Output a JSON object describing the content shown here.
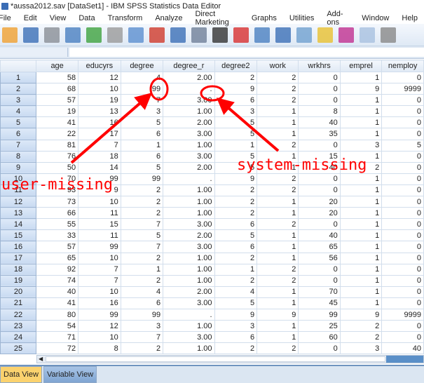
{
  "window": {
    "title": "*aussa2012.sav [DataSet1] - IBM SPSS Statistics Data Editor"
  },
  "menu": [
    "File",
    "Edit",
    "View",
    "Data",
    "Transform",
    "Analyze",
    "Direct Marketing",
    "Graphs",
    "Utilities",
    "Add-ons",
    "Window",
    "Help"
  ],
  "toolbar": [
    {
      "icon": "open-folder-icon",
      "color": "#f0a030"
    },
    {
      "icon": "save-icon",
      "color": "#3b6fb6"
    },
    {
      "icon": "print-icon",
      "color": "#8a8f96"
    },
    {
      "icon": "recall-dialog-icon",
      "color": "#4a7fc0"
    },
    {
      "icon": "undo-icon",
      "color": "#3fa33f"
    },
    {
      "icon": "redo-icon",
      "color": "#9a9a9a"
    },
    {
      "icon": "goto-case-icon",
      "color": "#5b8fd0"
    },
    {
      "icon": "goto-variable-icon",
      "color": "#d03a2a"
    },
    {
      "icon": "variables-icon",
      "color": "#3b6fb6"
    },
    {
      "icon": "run-descriptives-icon",
      "color": "#6f7f99"
    },
    {
      "icon": "find-icon",
      "color": "#333333"
    },
    {
      "icon": "insert-cases-icon",
      "color": "#d83030"
    },
    {
      "icon": "insert-variable-icon",
      "color": "#4a7fc0"
    },
    {
      "icon": "split-file-icon",
      "color": "#3b6fb6"
    },
    {
      "icon": "weight-cases-icon",
      "color": "#6fa0d0"
    },
    {
      "icon": "select-cases-icon",
      "color": "#e8c030"
    },
    {
      "icon": "value-labels-icon",
      "color": "#c03090"
    },
    {
      "icon": "use-sets-icon",
      "color": "#a8c0e0"
    },
    {
      "icon": "show-all-icon",
      "color": "#888888"
    }
  ],
  "grid": {
    "columns": [
      "age",
      "educyrs",
      "degree",
      "degree_r",
      "degree2",
      "work",
      "wrkhrs",
      "emprel",
      "nemploy"
    ],
    "rows": [
      [
        "1",
        "58",
        "12",
        "4",
        "2.00",
        "2",
        "2",
        "0",
        "1",
        "0"
      ],
      [
        "2",
        "68",
        "10",
        "99",
        ".",
        "9",
        "2",
        "0",
        "9",
        "9999"
      ],
      [
        "3",
        "57",
        "19",
        "7",
        "3.00",
        "6",
        "2",
        "0",
        "1",
        "0"
      ],
      [
        "4",
        "19",
        "13",
        "3",
        "1.00",
        "3",
        "1",
        "8",
        "1",
        "0"
      ],
      [
        "5",
        "41",
        "16",
        "5",
        "2.00",
        "5",
        "1",
        "40",
        "1",
        "0"
      ],
      [
        "6",
        "22",
        "17",
        "6",
        "3.00",
        "5",
        "1",
        "35",
        "1",
        "0"
      ],
      [
        "7",
        "81",
        "7",
        "1",
        "1.00",
        "1",
        "2",
        "0",
        "3",
        "5"
      ],
      [
        "8",
        "76",
        "18",
        "6",
        "3.00",
        "5",
        "1",
        "15",
        "1",
        "0"
      ],
      [
        "9",
        "50",
        "14",
        "5",
        "2.00",
        "5",
        "1",
        "40",
        "2",
        "0"
      ],
      [
        "10",
        "70",
        "99",
        "99",
        ".",
        "9",
        "2",
        "0",
        "1",
        "0"
      ],
      [
        "11",
        "93",
        "9",
        "2",
        "1.00",
        "2",
        "2",
        "0",
        "1",
        "0"
      ],
      [
        "12",
        "73",
        "10",
        "2",
        "1.00",
        "2",
        "1",
        "20",
        "1",
        "0"
      ],
      [
        "13",
        "66",
        "11",
        "2",
        "1.00",
        "2",
        "1",
        "20",
        "1",
        "0"
      ],
      [
        "14",
        "55",
        "15",
        "7",
        "3.00",
        "6",
        "2",
        "0",
        "1",
        "0"
      ],
      [
        "15",
        "33",
        "11",
        "5",
        "2.00",
        "5",
        "1",
        "40",
        "1",
        "0"
      ],
      [
        "16",
        "57",
        "99",
        "7",
        "3.00",
        "6",
        "1",
        "65",
        "1",
        "0"
      ],
      [
        "17",
        "65",
        "10",
        "2",
        "1.00",
        "2",
        "1",
        "56",
        "1",
        "0"
      ],
      [
        "18",
        "92",
        "7",
        "1",
        "1.00",
        "1",
        "2",
        "0",
        "1",
        "0"
      ],
      [
        "19",
        "74",
        "7",
        "2",
        "1.00",
        "2",
        "2",
        "0",
        "1",
        "0"
      ],
      [
        "20",
        "40",
        "10",
        "4",
        "2.00",
        "4",
        "1",
        "70",
        "1",
        "0"
      ],
      [
        "21",
        "41",
        "16",
        "6",
        "3.00",
        "5",
        "1",
        "45",
        "1",
        "0"
      ],
      [
        "22",
        "80",
        "99",
        "99",
        ".",
        "9",
        "9",
        "99",
        "9",
        "9999"
      ],
      [
        "23",
        "54",
        "12",
        "3",
        "1.00",
        "3",
        "1",
        "25",
        "2",
        "0"
      ],
      [
        "24",
        "71",
        "10",
        "7",
        "3.00",
        "6",
        "1",
        "60",
        "2",
        "0"
      ],
      [
        "25",
        "72",
        "8",
        "2",
        "1.00",
        "2",
        "2",
        "0",
        "3",
        "40"
      ]
    ]
  },
  "tabs": {
    "data_view": "Data View",
    "variable_view": "Variable View"
  },
  "annotations": {
    "user_missing": "user-missing",
    "system_missing": "system-missing",
    "color": "#ff0000"
  }
}
